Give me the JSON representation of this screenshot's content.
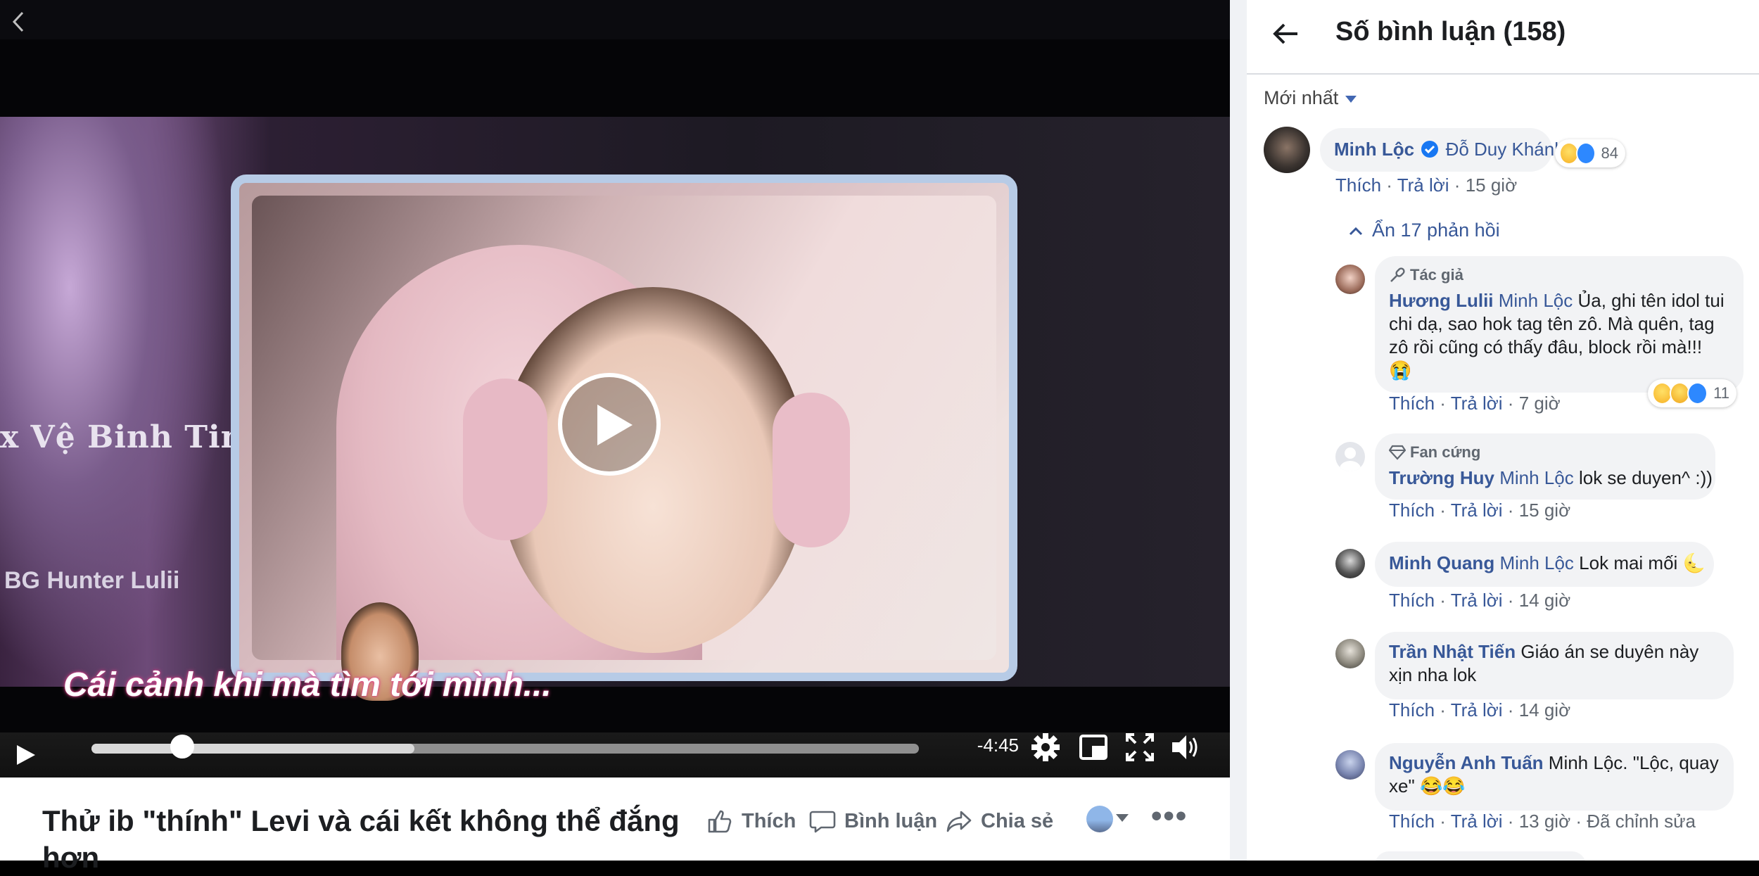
{
  "video": {
    "time_remaining": "-4:45",
    "progress_fraction": 0.11,
    "buffered_fraction": 0.39,
    "overlay_game_text": "x Vệ Binh Tinh",
    "overlay_game_text2": "BG Hunter Lulii",
    "overlay_subtitle": "Cái cảnh khi mà      tìm tới mình..."
  },
  "post": {
    "title_line1": "Thử ib \"thính\" Levi và cái kết không thể đắng",
    "title_line2": "hơn",
    "actions": {
      "like": "Thích",
      "comment": "Bình luận",
      "share": "Chia sẻ"
    }
  },
  "comments_panel": {
    "title": "Số bình luận (158)",
    "sort_label": "Mới nhất",
    "hide_replies_label": "Ẩn 17 phản hồi",
    "top_comment": {
      "author": "Minh Lộc",
      "tag": "Đỗ Duy Khánh",
      "reaction_count": "84",
      "like_label": "Thích",
      "reply_label": "Trả lời",
      "time": "15 giờ"
    },
    "replies": [
      {
        "badge": "Tác giả",
        "author": "Hương Lulii",
        "tag": "Minh Lộc",
        "text": "Ủa, ghi tên idol tui chi dạ, sao hok tag tên zô. Mà quên, tag zô rồi cũng có thấy đâu, block rồi mà!!!",
        "text_emoji": "😭",
        "reaction_count": "11",
        "like_label": "Thích",
        "reply_label": "Trả lời",
        "time": "7 giờ"
      },
      {
        "badge": "Fan cứng",
        "author": "Trường Huy",
        "tag": "Minh Lộc",
        "text": "lok se duyen^ :))",
        "like_label": "Thích",
        "reply_label": "Trả lời",
        "time": "15 giờ"
      },
      {
        "author": "Minh Quang",
        "tag": "Minh Lộc",
        "text": "Lok mai mối",
        "text_emoji": "🌜",
        "like_label": "Thích",
        "reply_label": "Trả lời",
        "time": "14 giờ"
      },
      {
        "author": "Trần Nhật Tiến",
        "text": "Giáo án se duyên này xịn nha lok",
        "like_label": "Thích",
        "reply_label": "Trả lời",
        "time": "14 giờ"
      },
      {
        "author": "Nguyễn Anh Tuấn",
        "text": "Minh Lộc. \"Lộc, quay xe\"",
        "text_emoji": "😂😂",
        "like_label": "Thích",
        "reply_label": "Trả lời",
        "time": "13 giờ",
        "edited": "Đã chỉnh sửa"
      }
    ]
  },
  "colors": {
    "link_blue": "#385898",
    "bubble_bg": "#f2f3f5",
    "meta_gray": "#606770",
    "panel_border": "#dadde1"
  }
}
